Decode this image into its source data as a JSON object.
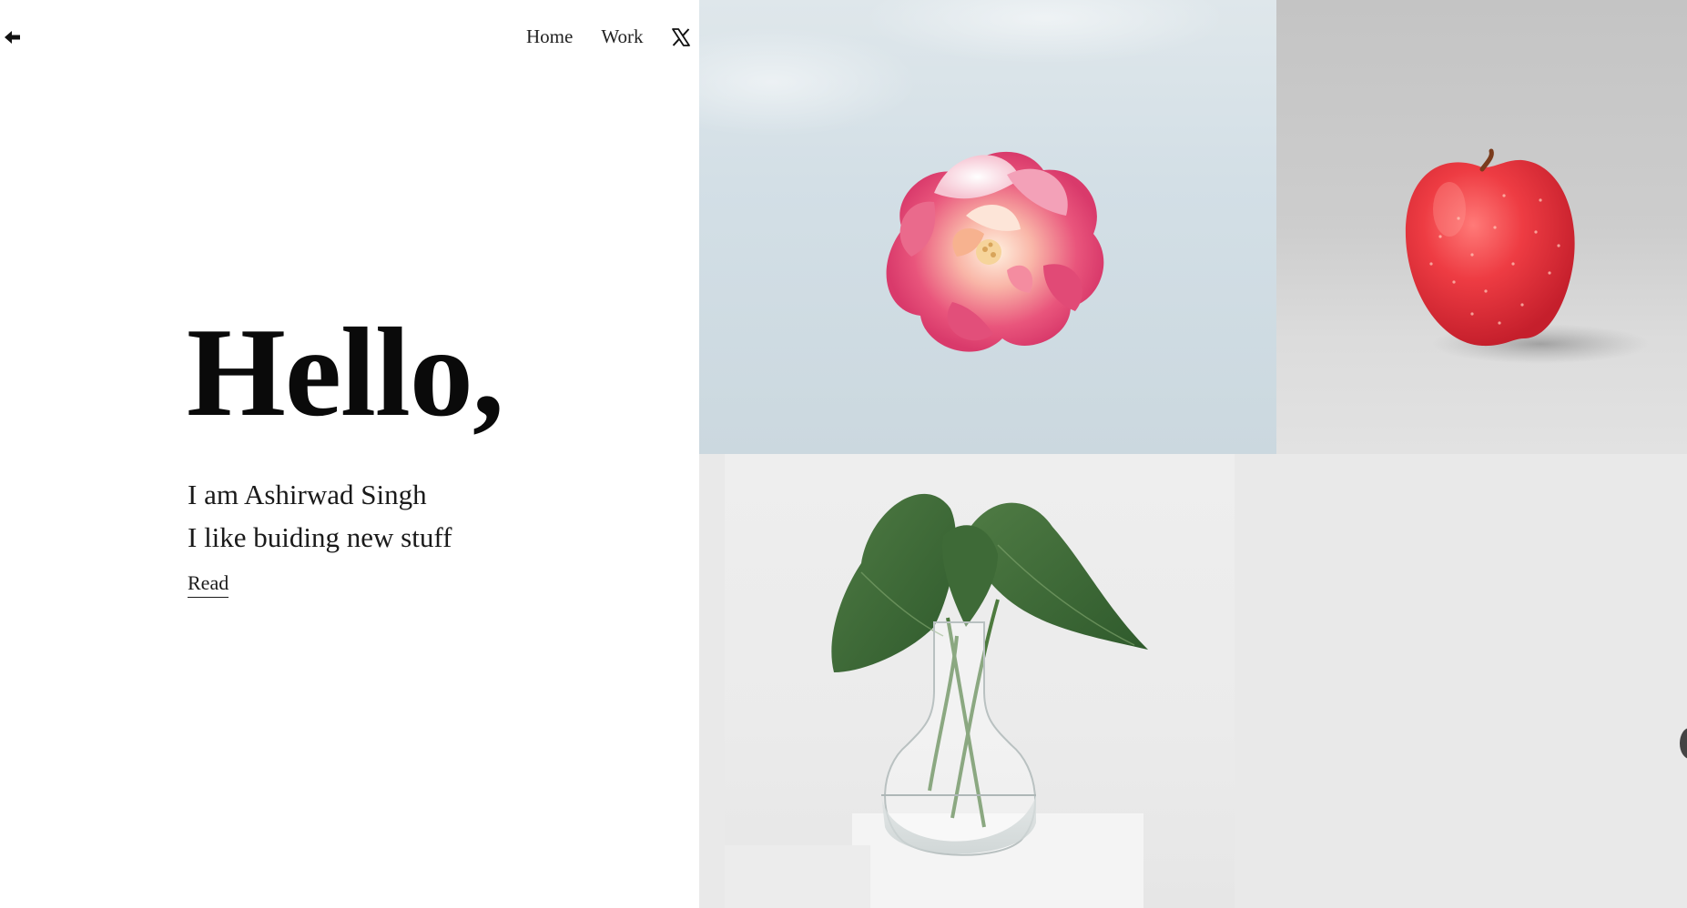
{
  "nav": {
    "back_icon": "arrow-left-icon",
    "home_label": "Home",
    "work_label": "Work",
    "social_icon": "x-logo-icon"
  },
  "hero": {
    "title": "Hello,",
    "line1": "I am Ashirwad Singh",
    "line2": "I like buiding new stuff",
    "read_label": "Read"
  },
  "gallery": {
    "images": [
      "pink-flower-image",
      "red-apple-image",
      "plant-in-vase-image"
    ]
  },
  "colors": {
    "text": "#111111",
    "flower_bg": "#d3dfe6",
    "apple_bg": "#c9c9c9",
    "plant_bg": "#e9e9e9"
  }
}
